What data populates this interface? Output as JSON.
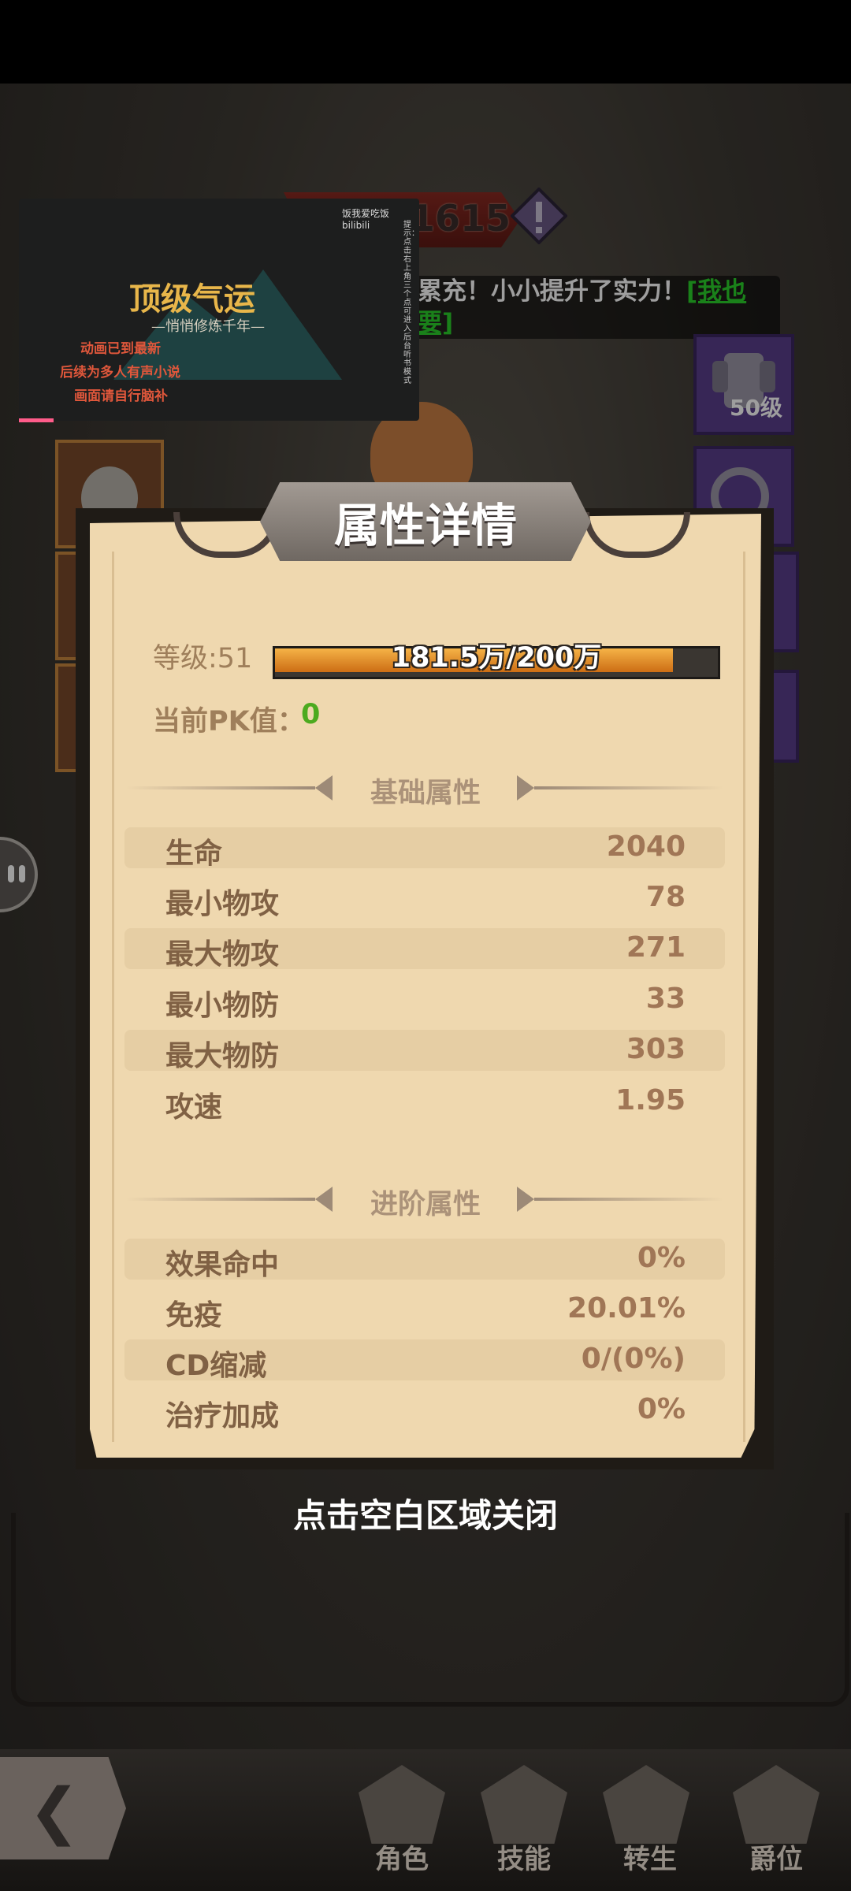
{
  "hud": {
    "power_value": "1615",
    "notice_text": "累充！小小提升了实力！",
    "notice_link": "[我也要]",
    "slot_level": "50级"
  },
  "video": {
    "brand": "饭我爱吃饭 bilibili",
    "title": "顶级气运",
    "subtitle": "—悄悄修炼千年—",
    "lines": [
      "动画已到最新",
      "后续为多人有声小说",
      "画面请自行脑补"
    ],
    "side_note": "提示：点击右上角三个点可进入后台听书模式"
  },
  "panel": {
    "title": "属性详情",
    "level_label": "等级:51",
    "exp_text": "181.5万/200万",
    "exp_fraction": 0.9075,
    "pk_label": "当前PK值：",
    "pk_value": "0",
    "basic_section": "基础属性",
    "basic_stats": [
      {
        "label": "生命",
        "value": "2040"
      },
      {
        "label": "最小物攻",
        "value": "78"
      },
      {
        "label": "最大物攻",
        "value": "271"
      },
      {
        "label": "最小物防",
        "value": "33"
      },
      {
        "label": "最大物防",
        "value": "303"
      },
      {
        "label": "攻速",
        "value": "1.95"
      }
    ],
    "advanced_section": "进阶属性",
    "advanced_stats": [
      {
        "label": "效果命中",
        "value": "0%"
      },
      {
        "label": "免疫",
        "value": "20.01%"
      },
      {
        "label": "CD缩减",
        "value": "0/(0%)"
      },
      {
        "label": "治疗加成",
        "value": "0%"
      }
    ]
  },
  "close_hint": "点击空白区域关闭",
  "nav": {
    "tabs": [
      {
        "label": "角色"
      },
      {
        "label": "技能"
      },
      {
        "label": "转生"
      },
      {
        "label": "爵位"
      }
    ]
  },
  "colors": {
    "panel_bg": "#efd8af",
    "stat_label": "#806144",
    "stat_value": "#a07656",
    "pk_value": "#4caa1f",
    "notice_link": "#2bd12b"
  }
}
